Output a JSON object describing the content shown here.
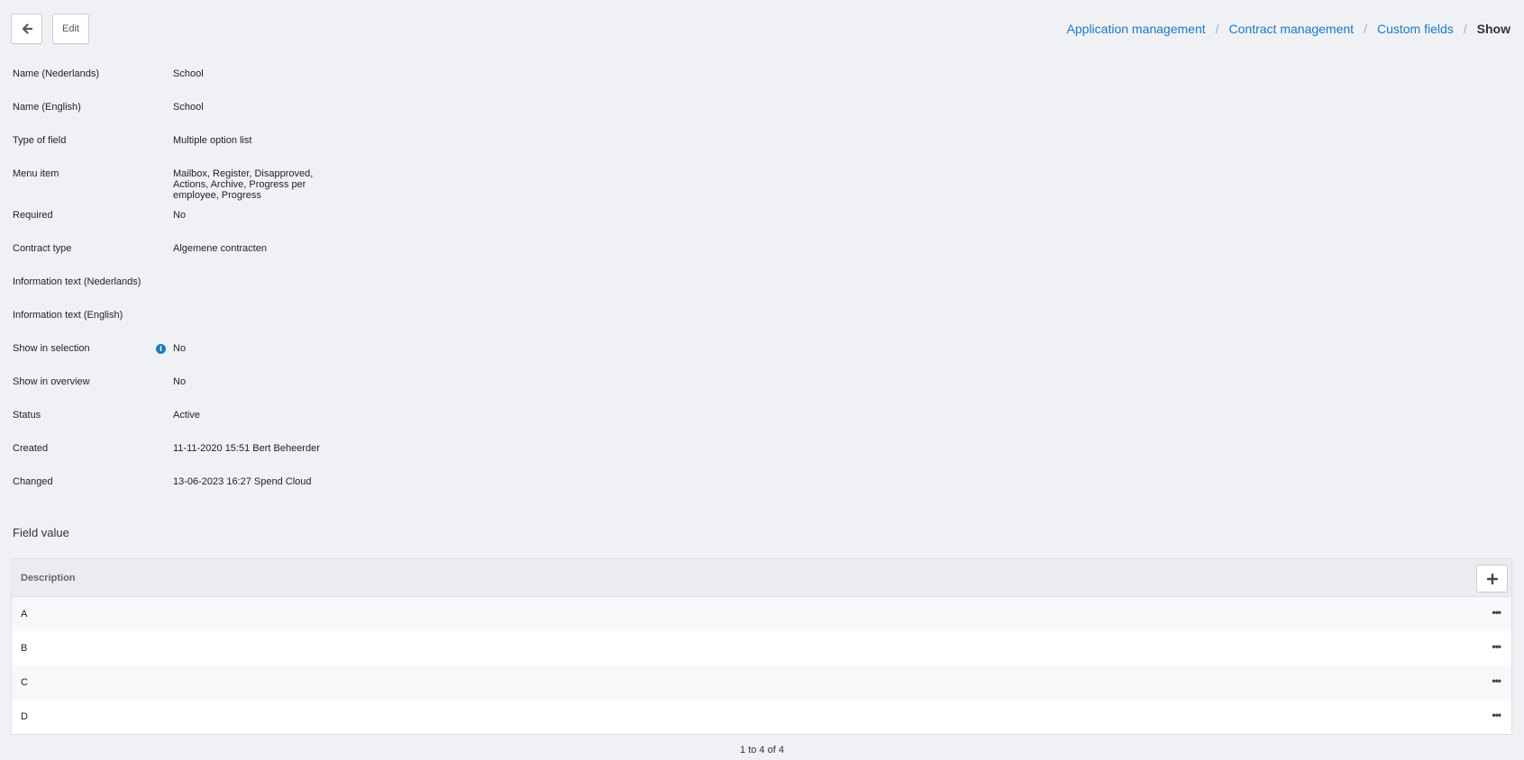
{
  "toolbar": {
    "back_icon": "arrow-left-icon",
    "edit_label": "Edit"
  },
  "breadcrumb": {
    "items": [
      "Application management",
      "Contract management",
      "Custom fields"
    ],
    "current": "Show",
    "separator": "/"
  },
  "details": [
    {
      "label": "Name (Nederlands)",
      "value": "School"
    },
    {
      "label": "Name (English)",
      "value": "School"
    },
    {
      "label": "Type of field",
      "value": "Multiple option list"
    },
    {
      "label": "Menu item",
      "value": "Mailbox, Register, Disapproved, Actions, Archive, Progress per employee, Progress"
    },
    {
      "label": "Required",
      "value": "No"
    },
    {
      "label": "Contract type",
      "value": "Algemene contracten"
    },
    {
      "label": "Information text (Nederlands)",
      "value": ""
    },
    {
      "label": "Information text (English)",
      "value": ""
    },
    {
      "label": "Show in selection",
      "value": "No",
      "info_icon": "i"
    },
    {
      "label": "Show in overview",
      "value": "No"
    },
    {
      "label": "Status",
      "value": "Active"
    },
    {
      "label": "Created",
      "value": "11-11-2020 15:51 Bert Beheerder"
    },
    {
      "label": "Changed",
      "value": "13-06-2023 16:27 Spend Cloud"
    }
  ],
  "field_value": {
    "title": "Field value",
    "column": "Description",
    "add_icon": "plus-icon",
    "rows": [
      "A",
      "B",
      "C",
      "D"
    ],
    "pager": "1 to 4 of 4"
  },
  "colors": {
    "link": "#1a7ac0",
    "background": "#f0f1f5"
  }
}
